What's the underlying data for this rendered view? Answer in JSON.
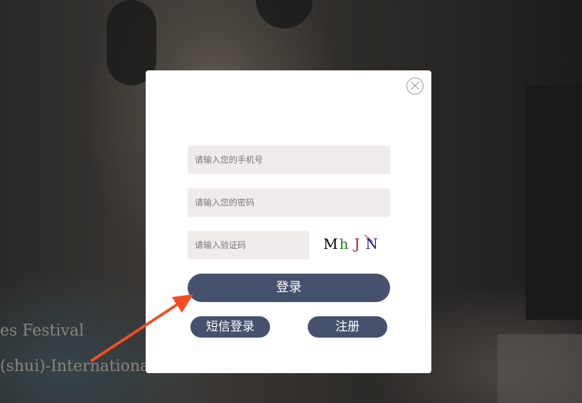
{
  "background": {
    "text_line_1": "es Festival",
    "text_line_2": "(shui)-Internationale"
  },
  "modal": {
    "close_icon": "close-icon",
    "phone_placeholder": "请输入您的手机号",
    "password_placeholder": "请输入您的密码",
    "captcha_placeholder": "请输入验证码",
    "captcha_chars": [
      "M",
      "h",
      "J",
      "N"
    ],
    "login_label": "登录",
    "sms_login_label": "短信登录",
    "register_label": "注册"
  },
  "colors": {
    "button": "#46516e",
    "input_bg": "#efebeb",
    "arrow": "#f04e23"
  }
}
